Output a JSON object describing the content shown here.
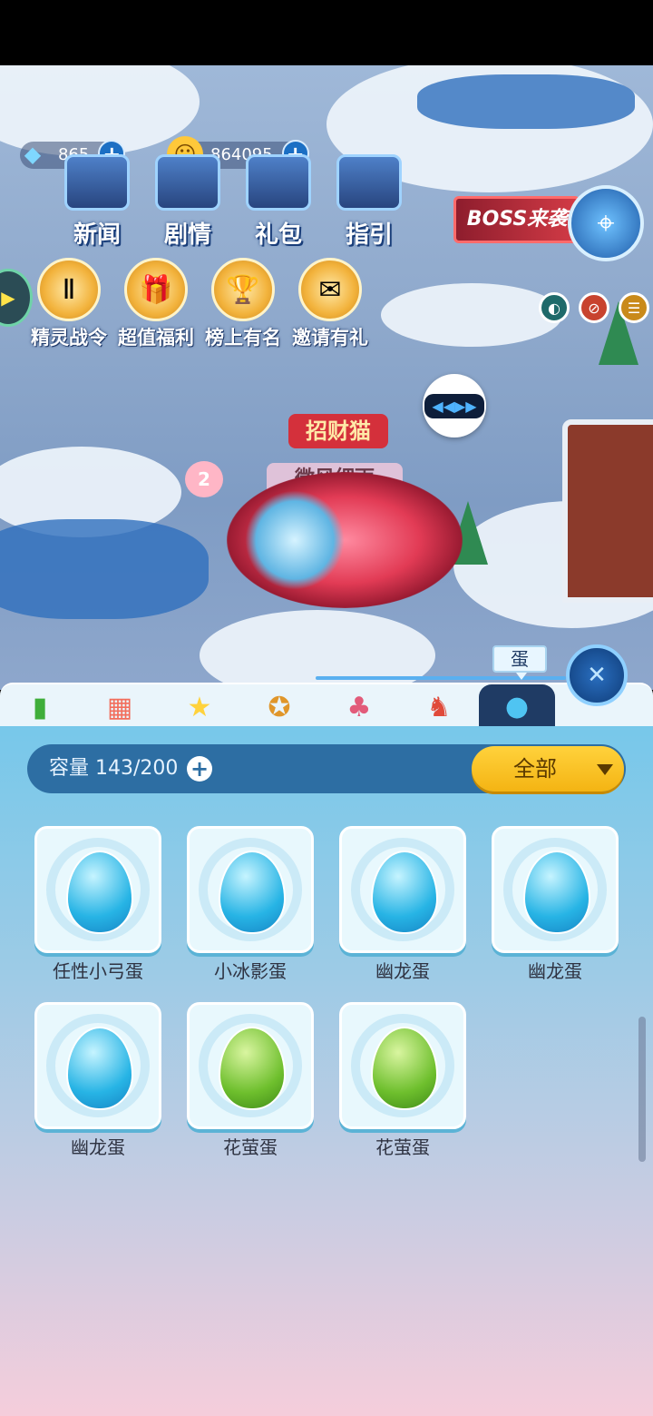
{
  "resources": {
    "gems": "865",
    "coins": "864095",
    "plus": "+"
  },
  "menu": [
    {
      "label": "新闻"
    },
    {
      "label": "剧情"
    },
    {
      "label": "礼包"
    },
    {
      "label": "指引"
    }
  ],
  "features": [
    {
      "label": "精灵战令"
    },
    {
      "label": "超值福利"
    },
    {
      "label": "榜上有名"
    },
    {
      "label": "邀请有礼"
    }
  ],
  "boss_banner": "BOSS来袭",
  "pet": {
    "title": "招财猫",
    "name": "微风细雨",
    "level": "2"
  },
  "tabs": {
    "active_tip": "蛋"
  },
  "capacity": {
    "label": "容量",
    "value": "143/200",
    "plus": "+"
  },
  "filter": {
    "selected": "全部"
  },
  "eggs": [
    {
      "name": "任性小弓蛋",
      "color": "blue"
    },
    {
      "name": "小冰影蛋",
      "color": "blue"
    },
    {
      "name": "幽龙蛋",
      "color": "blue"
    },
    {
      "name": "幽龙蛋",
      "color": "blue"
    },
    {
      "name": "幽龙蛋",
      "color": "blue"
    },
    {
      "name": "花萤蛋",
      "color": "green"
    },
    {
      "name": "花萤蛋",
      "color": "green"
    }
  ],
  "colors": {
    "panel_bar": "#2d6ea3",
    "filter_yellow": "#f4b413",
    "active_tab": "#1f3b64"
  }
}
